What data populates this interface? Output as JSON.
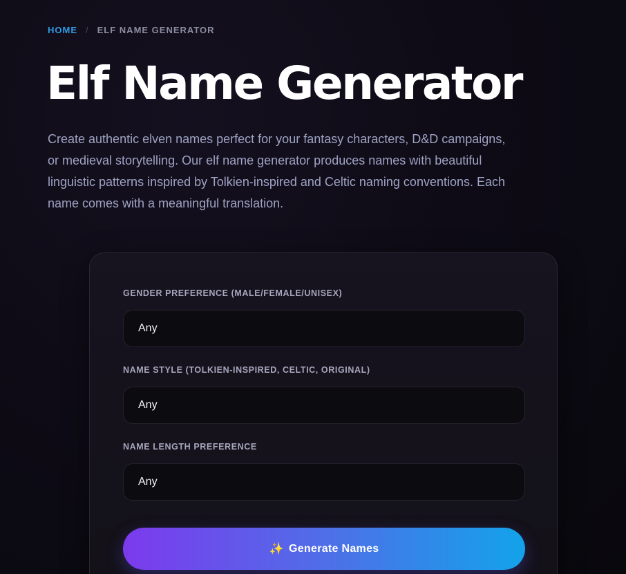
{
  "breadcrumb": {
    "home": "HOME",
    "separator": "/",
    "current": "ELF NAME GENERATOR"
  },
  "page": {
    "title": "Elf Name Generator",
    "intro": "Create authentic elven names perfect for your fantasy characters, D&D campaigns, or medieval storytelling. Our elf name generator produces names with beautiful linguistic patterns inspired by Tolkien-inspired and Celtic naming conventions. Each name comes with a meaningful translation."
  },
  "form": {
    "fields": [
      {
        "label": "GENDER PREFERENCE (MALE/FEMALE/UNISEX)",
        "value": "Any"
      },
      {
        "label": "NAME STYLE (TOLKIEN-INSPIRED, CELTIC, ORIGINAL)",
        "value": "Any"
      },
      {
        "label": "NAME LENGTH PREFERENCE",
        "value": "Any"
      }
    ],
    "generate_button": {
      "icon": "sparkle-icon",
      "icon_glyph": "✨",
      "label": "Generate Names"
    }
  },
  "colors": {
    "accent_link": "#2f9be6",
    "button_gradient_start": "#7c3aed",
    "button_gradient_end": "#13a3ea"
  }
}
